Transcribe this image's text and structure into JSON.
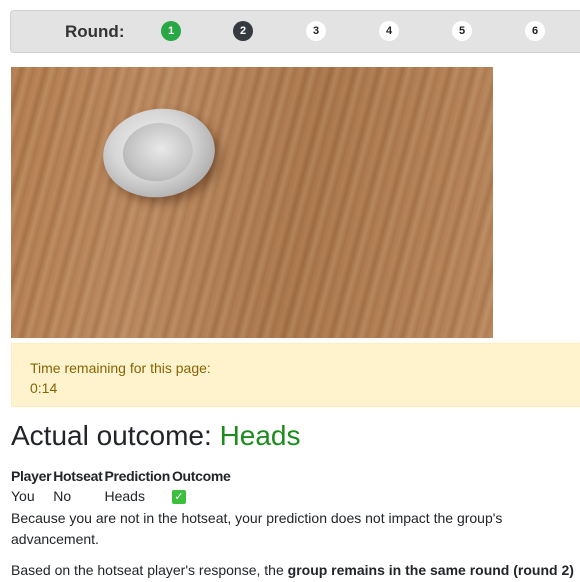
{
  "round_bar": {
    "label": "Round:",
    "rounds": [
      {
        "number": "1",
        "state": "completed",
        "color": "#28a745"
      },
      {
        "number": "2",
        "state": "current",
        "color": "#343a40"
      },
      {
        "number": "3",
        "state": "upcoming"
      },
      {
        "number": "4",
        "state": "upcoming"
      },
      {
        "number": "5",
        "state": "upcoming"
      },
      {
        "number": "6",
        "state": "upcoming"
      }
    ]
  },
  "photo": {
    "subject": "coin-on-wooden-table"
  },
  "timer": {
    "label": "Time remaining for this page:",
    "value": "0:14",
    "background": "#fff3cd",
    "text_color": "#856404"
  },
  "outcome": {
    "prefix": "Actual outcome: ",
    "result": "Heads",
    "result_color": "#1e8b1e"
  },
  "table": {
    "headers": [
      "Player",
      "Hotseat",
      "Prediction",
      "Outcome"
    ],
    "rows": [
      {
        "player": "You",
        "hotseat": "No",
        "prediction": "Heads",
        "outcome_icon": "check-mark-icon",
        "outcome_glyph": "✓"
      }
    ]
  },
  "messages": {
    "not_in_hotseat": "Because you are not in the hotseat, your prediction does not impact the group's advancement.",
    "hotseat_prefix": "Based on the hotseat player's response, the ",
    "hotseat_bold": "group remains in the same round (round 2)"
  }
}
